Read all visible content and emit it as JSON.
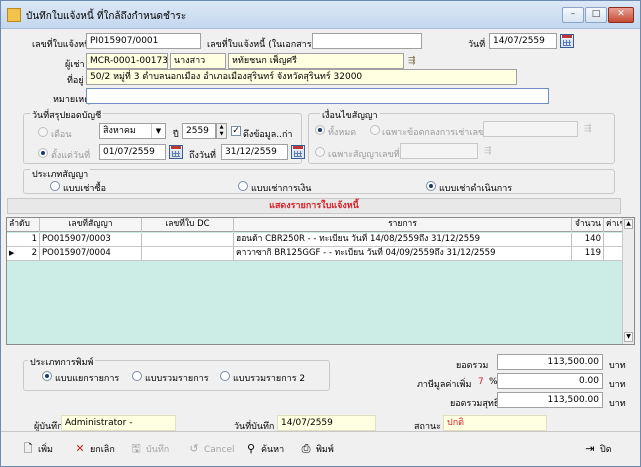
{
  "window": {
    "title": "บันทึกใบแจ้งหนี้ ที่ใกล้ถึงกำหนดชำระ",
    "btn_min": "–",
    "btn_max": "□",
    "btn_close": "✕"
  },
  "header": {
    "invoice_no_label": "เลขที่ใบแจ้งหนี้",
    "invoice_no": "PI015907/0001",
    "doc_no_label": "เลขที่ใบแจ้งหนี้ (ในเอกสาร)",
    "doc_no": "",
    "date_label": "วันที่",
    "date": "14/07/2559",
    "customer_label": "ผู้เช่า",
    "customer_code": "MCR-0001-00173",
    "customer_prefix": "นางสาว",
    "customer_name": "หทัยชนก เพ็ญศรี",
    "address_label": "ที่อยู่",
    "address": "50/2 หมู่ที่ 3 ตำบลนอกเมือง อำเภอเมืองสุรินทร์ จังหวัดสุรินทร์ 32000",
    "remark_label": "หมายเหตุ",
    "remark": ""
  },
  "summary_period": {
    "group_label": "วันที่สรุปยอดบัญชี",
    "opt_month": "เดือน",
    "month": "สิงหาคม",
    "year_label": "ปี",
    "year": "2559",
    "pull_label": "ดึงข้อมูล..ก่า",
    "opt_from": "ตั้งแต่วันที่",
    "from_date": "01/07/2559",
    "to_label": "ถึงวันที่",
    "to_date": "31/12/2559"
  },
  "contract_cond": {
    "group_label": "เงื่อนไขสัญญา",
    "opt_all": "ทั้งหมด",
    "opt_by_contract": "เฉพาะข้อตกลงการเช่าเลขที่",
    "opt_by_no": "เฉพาะสัญญาเลขที่"
  },
  "contract_type": {
    "group_label": "ประเภทสัญญา",
    "opt_buy": "แบบเช่าซื้อ",
    "opt_loan": "แบบเช่าการเงิน",
    "opt_op": "แบบเช่าดำเนินการ"
  },
  "banner": "แสดงรายการใบแจ้งหนี้",
  "table": {
    "headers": [
      "ลำดับ",
      "เลขที่สัญญา",
      "เลขที่ใบ DC",
      "รายการ",
      "จำนวน",
      "ค่าเช่า"
    ],
    "rows": [
      {
        "no": "1",
        "contract": "PO015907/0003",
        "dc": "",
        "item": "ฮอนด้า CBR250R - - ทะเบียน  วันที่ 14/08/2559ถึง 31/12/2559",
        "amount": "140"
      },
      {
        "no": "2",
        "contract": "PO015907/0004",
        "dc": "",
        "item": "คาวาซากิ BR125GGF - - ทะเบียน  วันที่ 04/09/2559ถึง 31/12/2559",
        "amount": "119"
      }
    ]
  },
  "print_type": {
    "group_label": "ประเภทการพิมพ์",
    "opt_separate": "แบบแยกรายการ",
    "opt_combine": "แบบรวมรายการ",
    "opt_combine2": "แบบรวมรายการ 2"
  },
  "totals": {
    "subtotal_label": "ยอดรวม",
    "subtotal": "113,500.00",
    "vat_label": "ภาษีมูลค่าเพิ่ม",
    "vat_rate": "7",
    "vat_pct": "%",
    "vat": "0.00",
    "net_label": "ยอดรวมสุทธิ",
    "net": "113,500.00",
    "unit": "บาท"
  },
  "footer": {
    "recorder_label": "ผู้บันทึก",
    "recorder": "Administrator -",
    "rec_date_label": "วันที่บันทึก",
    "rec_date": "14/07/2559",
    "status_label": "สถานะ",
    "status": "ปกติ"
  },
  "toolbar": {
    "add": "เพิ่ม",
    "cancel_doc": "ยกเลิก",
    "save": "บันทึก",
    "cancel": "Cancel",
    "search": "ค้นหา",
    "print": "พิมพ์",
    "close": "ปิด"
  },
  "colors": {
    "banner_text": "#d8232a",
    "grid_bg": "#ccece6",
    "status_text": "#d8232a"
  }
}
